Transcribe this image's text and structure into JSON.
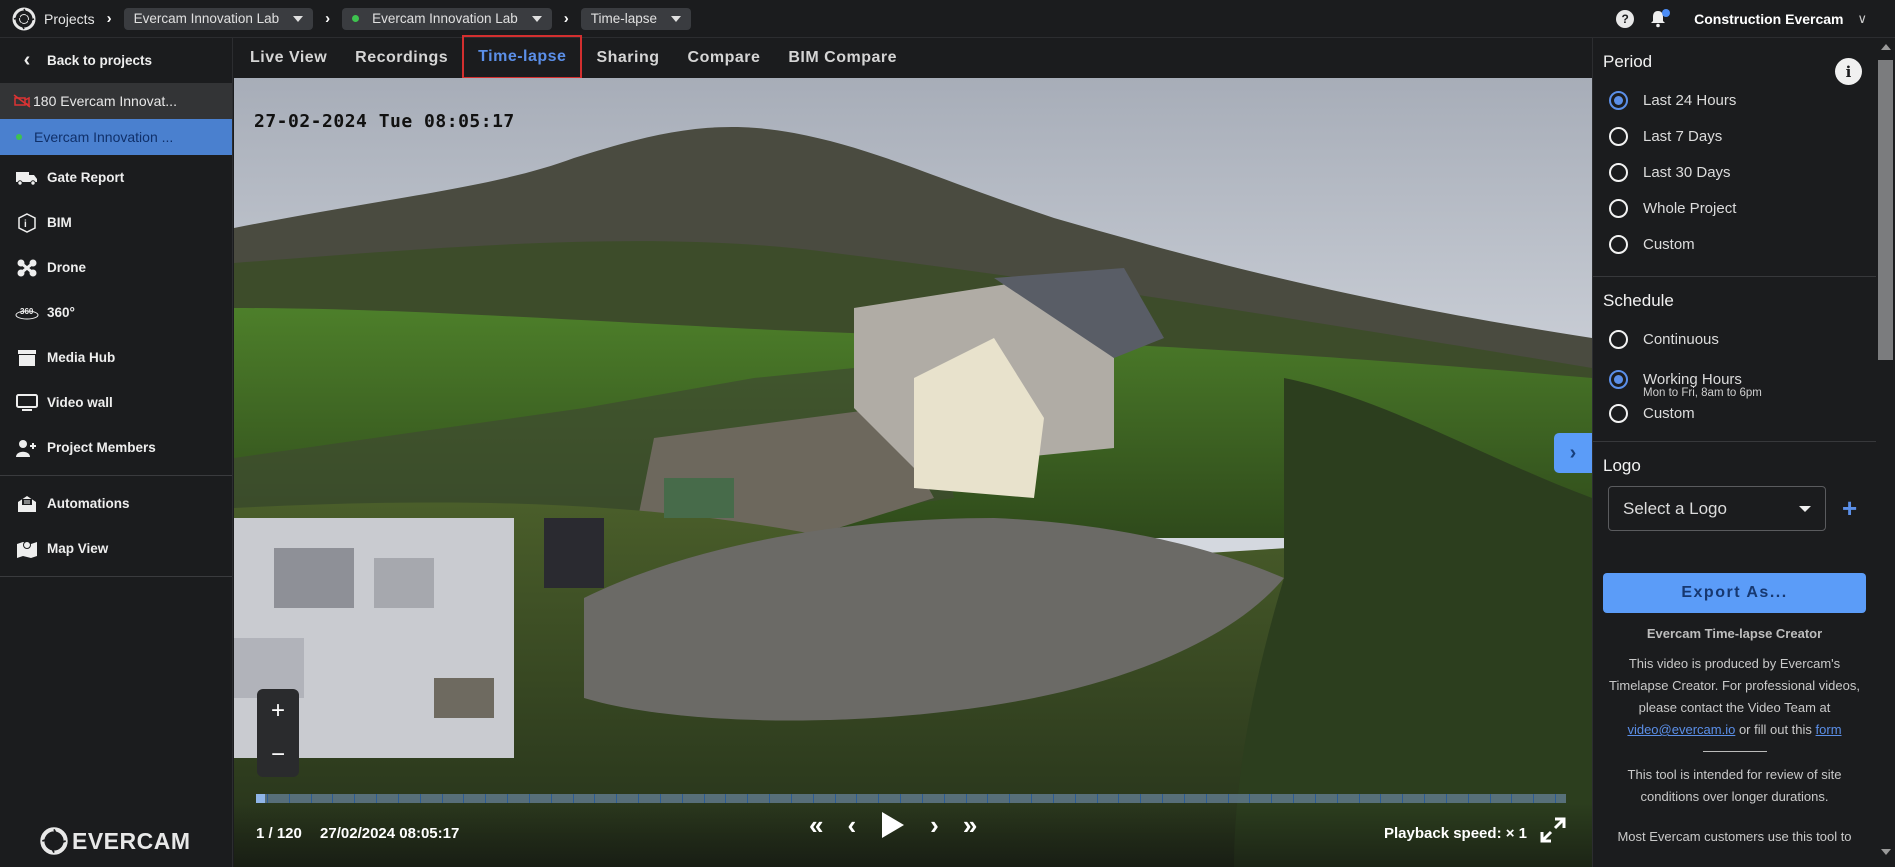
{
  "topbar": {
    "projects_label": "Projects",
    "project_select": "Evercam Innovation Lab",
    "camera_select": "Evercam Innovation Lab",
    "camera_status_color": "#3ec34f",
    "view_select": "Time-lapse",
    "help_icon": "question-circle-icon",
    "notifications_icon": "bell-icon",
    "user_name": "Construction Evercam"
  },
  "sidebar": {
    "back_label": "Back to projects",
    "cameras": [
      {
        "label": "180 Evercam Innovat...",
        "status": "offline"
      },
      {
        "label": "Evercam Innovation ...",
        "status": "online",
        "selected": true
      }
    ],
    "items": [
      {
        "label": "Gate Report",
        "icon": "truck-icon"
      },
      {
        "label": "BIM",
        "icon": "bim-icon"
      },
      {
        "label": "Drone",
        "icon": "drone-icon"
      },
      {
        "label": "360°",
        "icon": "360-icon"
      },
      {
        "label": "Media Hub",
        "icon": "archive-box-icon"
      },
      {
        "label": "Video wall",
        "icon": "monitor-icon"
      },
      {
        "label": "Project Members",
        "icon": "add-user-icon"
      }
    ],
    "items2": [
      {
        "label": "Automations",
        "icon": "envelope-icon"
      },
      {
        "label": "Map View",
        "icon": "map-icon"
      }
    ],
    "brand": "EVERCAM"
  },
  "tabs": [
    {
      "label": "Live View"
    },
    {
      "label": "Recordings"
    },
    {
      "label": "Time-lapse",
      "active": true
    },
    {
      "label": "Sharing"
    },
    {
      "label": "Compare"
    },
    {
      "label": "BIM Compare"
    }
  ],
  "player": {
    "overlay_timestamp": "27-02-2024 Tue 08:05:17",
    "frame_counter": "1 / 120",
    "frame_datetime": "27/02/2024 08:05:17",
    "current_frame": 1,
    "total_frames": 120,
    "playback_speed": "Playback speed: × 1",
    "zoom_in": "+",
    "zoom_out": "−"
  },
  "right_panel": {
    "period": {
      "title": "Period",
      "options": [
        "Last 24 Hours",
        "Last 7 Days",
        "Last 30 Days",
        "Whole Project",
        "Custom"
      ],
      "selected": "Last 24 Hours"
    },
    "schedule": {
      "title": "Schedule",
      "options": [
        "Continuous",
        "Working Hours",
        "Custom"
      ],
      "working_hours_sub": "Mon to Fri, 8am to 6pm",
      "selected": "Working Hours"
    },
    "logo": {
      "title": "Logo",
      "select_placeholder": "Select a Logo"
    },
    "export_label": "Export As...",
    "creator_title": "Evercam Time-lapse Creator",
    "creator_text_1": "This video is produced by Evercam's Timelapse Creator. For professional videos, please contact the Video Team at",
    "email_link": "video@evercam.io",
    "creator_text_2": "or fill out this",
    "form_link": "form",
    "tool_text": "This tool is intended for review of site conditions over longer durations.",
    "more_text": "Most Evercam customers use this tool to"
  },
  "colors": {
    "accent": "#5b8fe8",
    "button": "#5b9cf8",
    "active_tab_outline": "#d32f2f",
    "selected_camera_bg": "#4a80cf"
  }
}
